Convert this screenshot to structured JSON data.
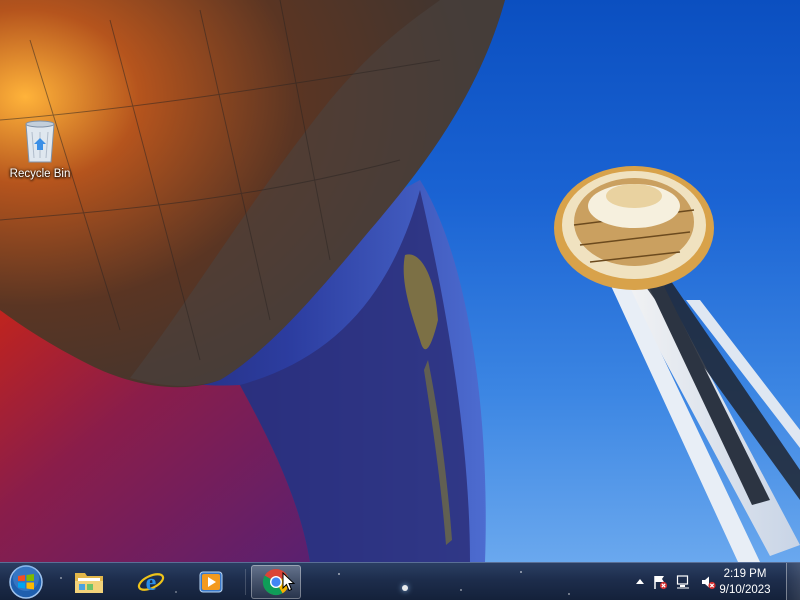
{
  "desktop": {
    "icons": [
      {
        "label": "Recycle Bin",
        "icon": "recycle-bin-icon"
      }
    ]
  },
  "taskbar": {
    "start": {
      "icon": "windows-start-orb-icon"
    },
    "pinned": [
      {
        "name": "Windows Explorer",
        "icon": "folder-icon"
      },
      {
        "name": "Internet Explorer",
        "icon": "internet-explorer-icon"
      },
      {
        "name": "Windows Media Player",
        "icon": "media-player-icon"
      },
      {
        "name": "Google Chrome",
        "icon": "chrome-icon",
        "active": true
      }
    ],
    "tray": {
      "icons": [
        "show-hidden-icons-chevron",
        "action-center-flag-icon",
        "network-disconnected-icon",
        "volume-muted-icon"
      ],
      "time": "2:19 PM",
      "date": "9/10/2023"
    }
  },
  "colors": {
    "sky": "#1a63d3",
    "taskbar": "#1d2d4c",
    "tower_gold": "#d8a24a"
  }
}
